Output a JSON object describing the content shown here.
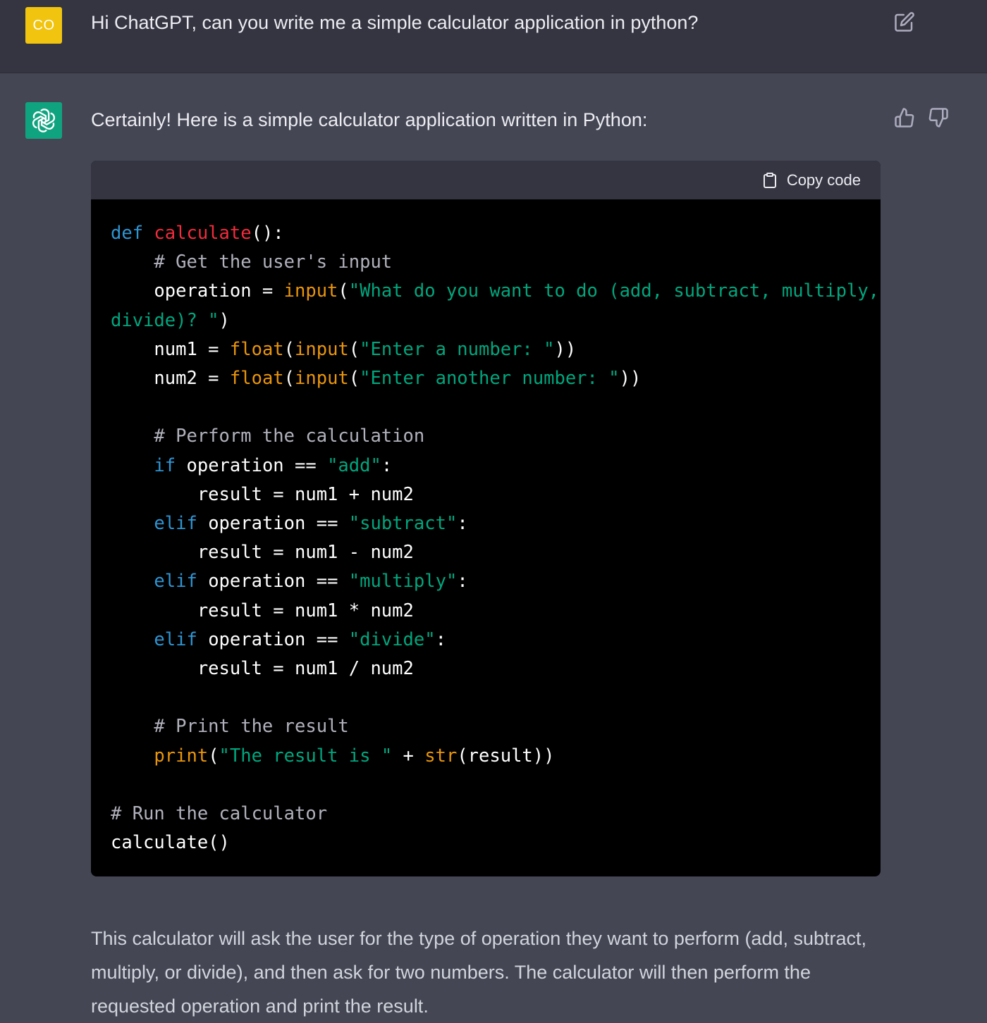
{
  "user_message": {
    "avatar_initials": "CO",
    "text": "Hi ChatGPT, can you write me a simple calculator application in python?",
    "edit_icon": "edit-icon"
  },
  "assistant_message": {
    "avatar_icon": "openai-logo-icon",
    "intro": "Certainly! Here is a simple calculator application written in Python:",
    "feedback": {
      "thumbs_up_icon": "thumbs-up-icon",
      "thumbs_down_icon": "thumbs-down-icon"
    },
    "code_block": {
      "copy_label": "Copy code",
      "copy_icon": "clipboard-icon",
      "lines": [
        [
          [
            "kw",
            "def"
          ],
          [
            "",
            " "
          ],
          [
            "fn",
            "calculate"
          ],
          [
            "",
            "():"
          ]
        ],
        [
          [
            "cm",
            "    # Get the user's input"
          ]
        ],
        [
          [
            "",
            "    operation = "
          ],
          [
            "bi",
            "input"
          ],
          [
            "",
            "("
          ],
          [
            "st",
            "\"What do you want to do (add, subtract, multiply,"
          ]
        ],
        [
          [
            "st",
            "divide)? \""
          ],
          [
            "",
            ")"
          ]
        ],
        [
          [
            "",
            "    num1 = "
          ],
          [
            "bi",
            "float"
          ],
          [
            "",
            "("
          ],
          [
            "bi",
            "input"
          ],
          [
            "",
            "("
          ],
          [
            "st",
            "\"Enter a number: \""
          ],
          [
            "",
            "))"
          ]
        ],
        [
          [
            "",
            "    num2 = "
          ],
          [
            "bi",
            "float"
          ],
          [
            "",
            "("
          ],
          [
            "bi",
            "input"
          ],
          [
            "",
            "("
          ],
          [
            "st",
            "\"Enter another number: \""
          ],
          [
            "",
            "))"
          ]
        ],
        [
          [
            "",
            ""
          ]
        ],
        [
          [
            "cm",
            "    # Perform the calculation"
          ]
        ],
        [
          [
            "",
            "    "
          ],
          [
            "kw",
            "if"
          ],
          [
            "",
            ""
          ],
          [
            "",
            " operation == "
          ],
          [
            "st",
            "\"add\""
          ],
          [
            "",
            ":"
          ]
        ],
        [
          [
            "",
            "        result = num1 + num2"
          ]
        ],
        [
          [
            "",
            "    "
          ],
          [
            "kw",
            "elif"
          ],
          [
            "",
            " operation == "
          ],
          [
            "st",
            "\"subtract\""
          ],
          [
            "",
            ":"
          ]
        ],
        [
          [
            "",
            "        result = num1 - num2"
          ]
        ],
        [
          [
            "",
            "    "
          ],
          [
            "kw",
            "elif"
          ],
          [
            "",
            " operation == "
          ],
          [
            "st",
            "\"multiply\""
          ],
          [
            "",
            ":"
          ]
        ],
        [
          [
            "",
            "        result = num1 * num2"
          ]
        ],
        [
          [
            "",
            "    "
          ],
          [
            "kw",
            "elif"
          ],
          [
            "",
            " operation == "
          ],
          [
            "st",
            "\"divide\""
          ],
          [
            "",
            ":"
          ]
        ],
        [
          [
            "",
            "        result = num1 / num2"
          ]
        ],
        [
          [
            "",
            ""
          ]
        ],
        [
          [
            "cm",
            "    # Print the result"
          ]
        ],
        [
          [
            "",
            "    "
          ],
          [
            "bi",
            "print"
          ],
          [
            "",
            "("
          ],
          [
            "st",
            "\"The result is \""
          ],
          [
            "",
            " + "
          ],
          [
            "bi",
            "str"
          ],
          [
            "",
            "(result))"
          ]
        ],
        [
          [
            "",
            ""
          ]
        ],
        [
          [
            "cm",
            "# Run the calculator"
          ]
        ],
        [
          [
            "",
            "calculate()"
          ]
        ]
      ]
    },
    "explanation": "This calculator will ask the user for the type of operation they want to perform (add, subtract, multiply, or divide), and then ask for two numbers. The calculator will then perform the requested operation and print the result."
  },
  "colors": {
    "user_bg": "#343541",
    "assistant_bg": "#444654",
    "code_bg": "#000000",
    "keyword": "#2e95d3",
    "function_name": "#f22c3d",
    "builtin": "#e9950c",
    "string": "#00a67d",
    "avatar_user": "#f0c40f",
    "avatar_bot": "#10a37f"
  }
}
